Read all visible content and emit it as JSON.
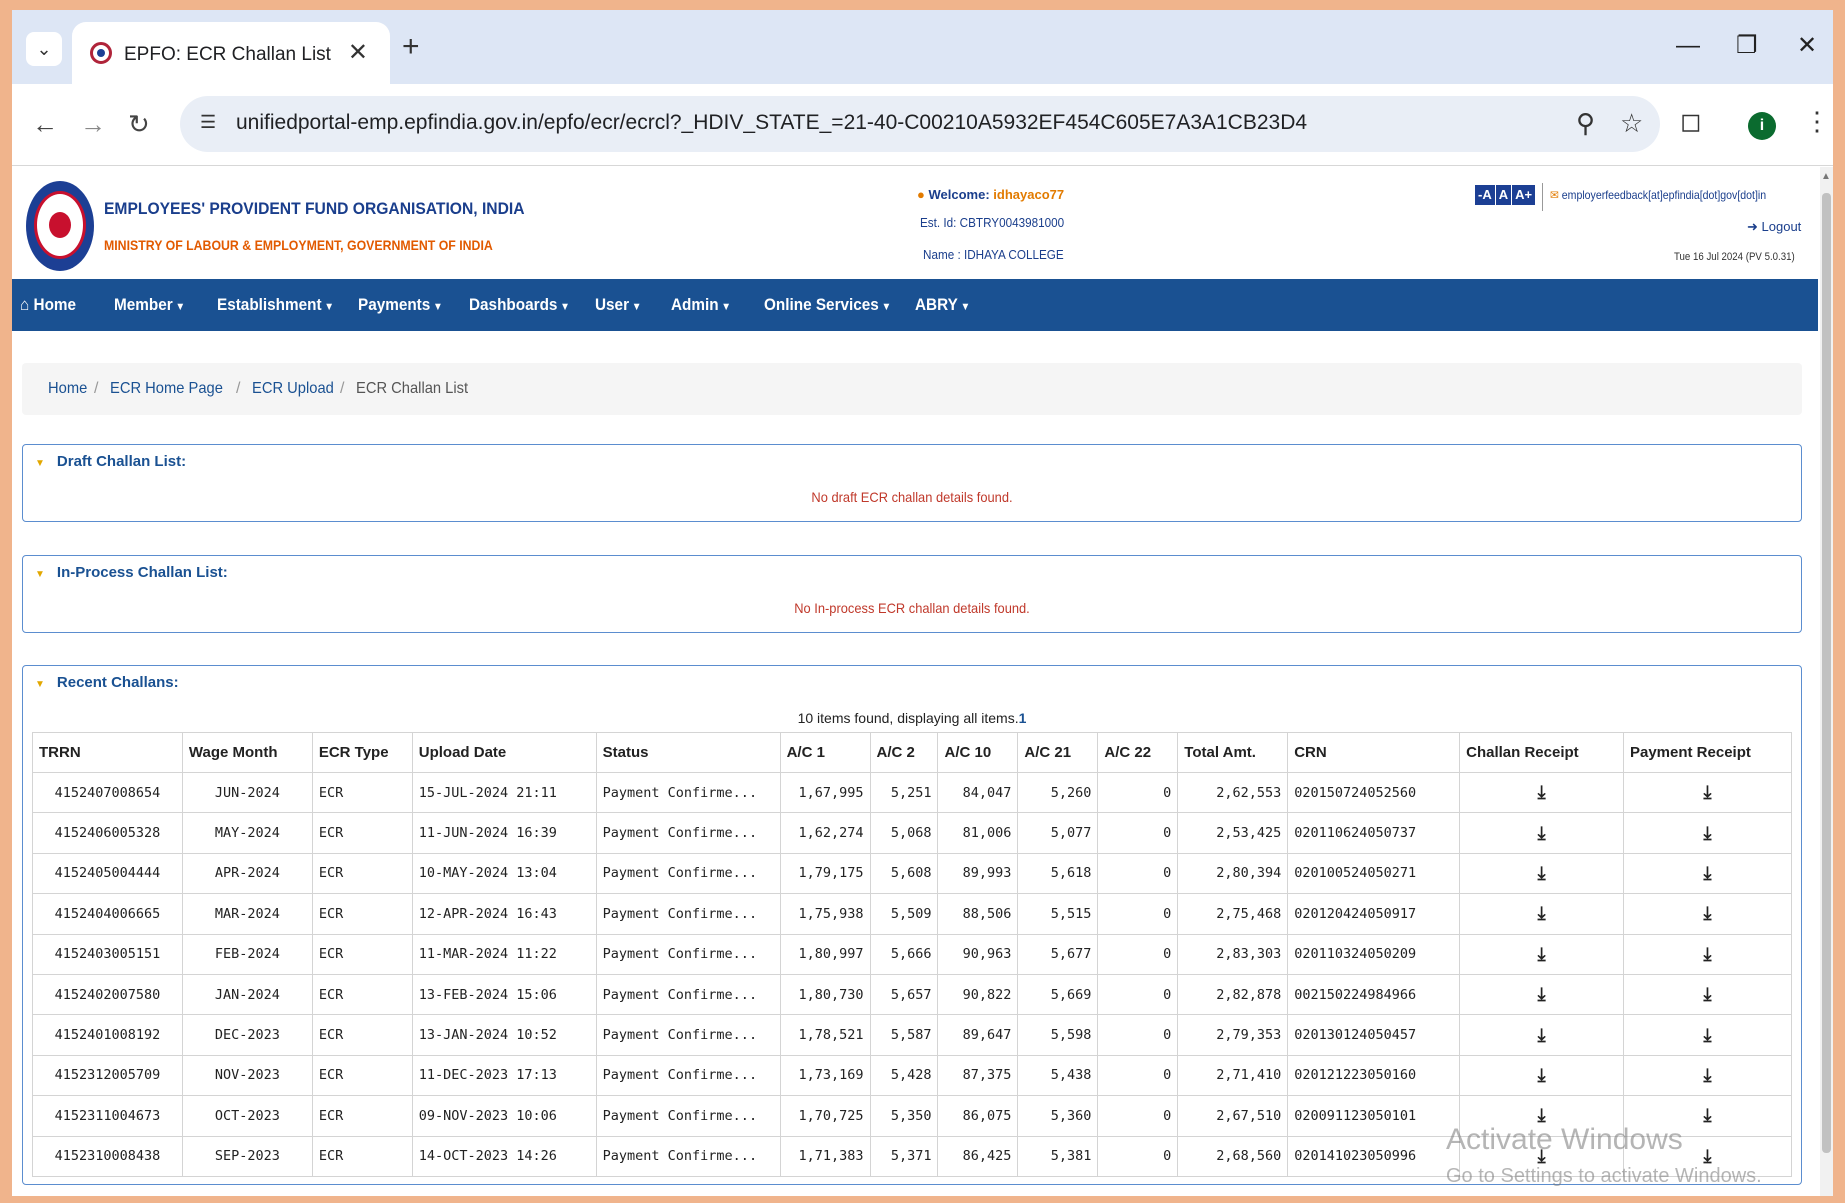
{
  "browser": {
    "tab_title": "EPFO: ECR Challan List",
    "url": "unifiedportal-emp.epfindia.gov.in/epfo/ecr/ecrcl?_HDIV_STATE_=21-40-C00210A5932EF454C605E7A3A1CB23D4",
    "profile_initial": "i"
  },
  "header": {
    "org_name": "EMPLOYEES' PROVIDENT FUND ORGANISATION, INDIA",
    "ministry": "MINISTRY OF LABOUR & EMPLOYMENT, GOVERNMENT OF INDIA",
    "welcome_label": "Welcome:",
    "username": "idhayaco77",
    "est_id": "Est. Id: CBTRY0043981000",
    "name": "Name : IDHAYA COLLEGE",
    "font_buttons": [
      "-A",
      "A",
      "A+"
    ],
    "feedback_email": "employerfeedback[at]epfindia[dot]gov[dot]in",
    "logout": "Logout",
    "date_version": "Tue 16 Jul 2024 (PV 5.0.31)"
  },
  "nav": {
    "items": [
      "Home",
      "Member",
      "Establishment",
      "Payments",
      "Dashboards",
      "User",
      "Admin",
      "Online Services",
      "ABRY"
    ]
  },
  "breadcrumb": [
    "Home",
    "ECR Home Page",
    "ECR Upload",
    "ECR Challan List"
  ],
  "draft": {
    "title": "Draft Challan List:",
    "message": "No draft ECR challan details found."
  },
  "inprocess": {
    "title": "In-Process Challan List:",
    "message": "No In-process ECR challan details found."
  },
  "recent": {
    "title": "Recent Challans:",
    "items_found": "10 items found, displaying all items.",
    "page": "1",
    "columns": [
      "TRRN",
      "Wage Month",
      "ECR Type",
      "Upload Date",
      "Status",
      "A/C 1",
      "A/C 2",
      "A/C 10",
      "A/C 21",
      "A/C 22",
      "Total Amt.",
      "CRN",
      "Challan Receipt",
      "Payment Receipt"
    ],
    "rows": [
      [
        "4152407008654",
        "JUN-2024",
        "ECR",
        "15-JUL-2024 21:11",
        "Payment Confirme...",
        "1,67,995",
        "5,251",
        "84,047",
        "5,260",
        "0",
        "2,62,553",
        "020150724052560"
      ],
      [
        "4152406005328",
        "MAY-2024",
        "ECR",
        "11-JUN-2024 16:39",
        "Payment Confirme...",
        "1,62,274",
        "5,068",
        "81,006",
        "5,077",
        "0",
        "2,53,425",
        "020110624050737"
      ],
      [
        "4152405004444",
        "APR-2024",
        "ECR",
        "10-MAY-2024 13:04",
        "Payment Confirme...",
        "1,79,175",
        "5,608",
        "89,993",
        "5,618",
        "0",
        "2,80,394",
        "020100524050271"
      ],
      [
        "4152404006665",
        "MAR-2024",
        "ECR",
        "12-APR-2024 16:43",
        "Payment Confirme...",
        "1,75,938",
        "5,509",
        "88,506",
        "5,515",
        "0",
        "2,75,468",
        "020120424050917"
      ],
      [
        "4152403005151",
        "FEB-2024",
        "ECR",
        "11-MAR-2024 11:22",
        "Payment Confirme...",
        "1,80,997",
        "5,666",
        "90,963",
        "5,677",
        "0",
        "2,83,303",
        "020110324050209"
      ],
      [
        "4152402007580",
        "JAN-2024",
        "ECR",
        "13-FEB-2024 15:06",
        "Payment Confirme...",
        "1,80,730",
        "5,657",
        "90,822",
        "5,669",
        "0",
        "2,82,878",
        "002150224984966"
      ],
      [
        "4152401008192",
        "DEC-2023",
        "ECR",
        "13-JAN-2024 10:52",
        "Payment Confirme...",
        "1,78,521",
        "5,587",
        "89,647",
        "5,598",
        "0",
        "2,79,353",
        "020130124050457"
      ],
      [
        "4152312005709",
        "NOV-2023",
        "ECR",
        "11-DEC-2023 17:13",
        "Payment Confirme...",
        "1,73,169",
        "5,428",
        "87,375",
        "5,438",
        "0",
        "2,71,410",
        "020121223050160"
      ],
      [
        "4152311004673",
        "OCT-2023",
        "ECR",
        "09-NOV-2023 10:06",
        "Payment Confirme...",
        "1,70,725",
        "5,350",
        "86,075",
        "5,360",
        "0",
        "2,67,510",
        "020091123050101"
      ],
      [
        "4152310008438",
        "SEP-2023",
        "ECR",
        "14-OCT-2023 14:26",
        "Payment Confirme...",
        "1,71,383",
        "5,371",
        "86,425",
        "5,381",
        "0",
        "2,68,560",
        "020141023050996"
      ]
    ]
  },
  "watermark": {
    "title": "Activate Windows",
    "subtitle": "Go to Settings to activate Windows."
  }
}
